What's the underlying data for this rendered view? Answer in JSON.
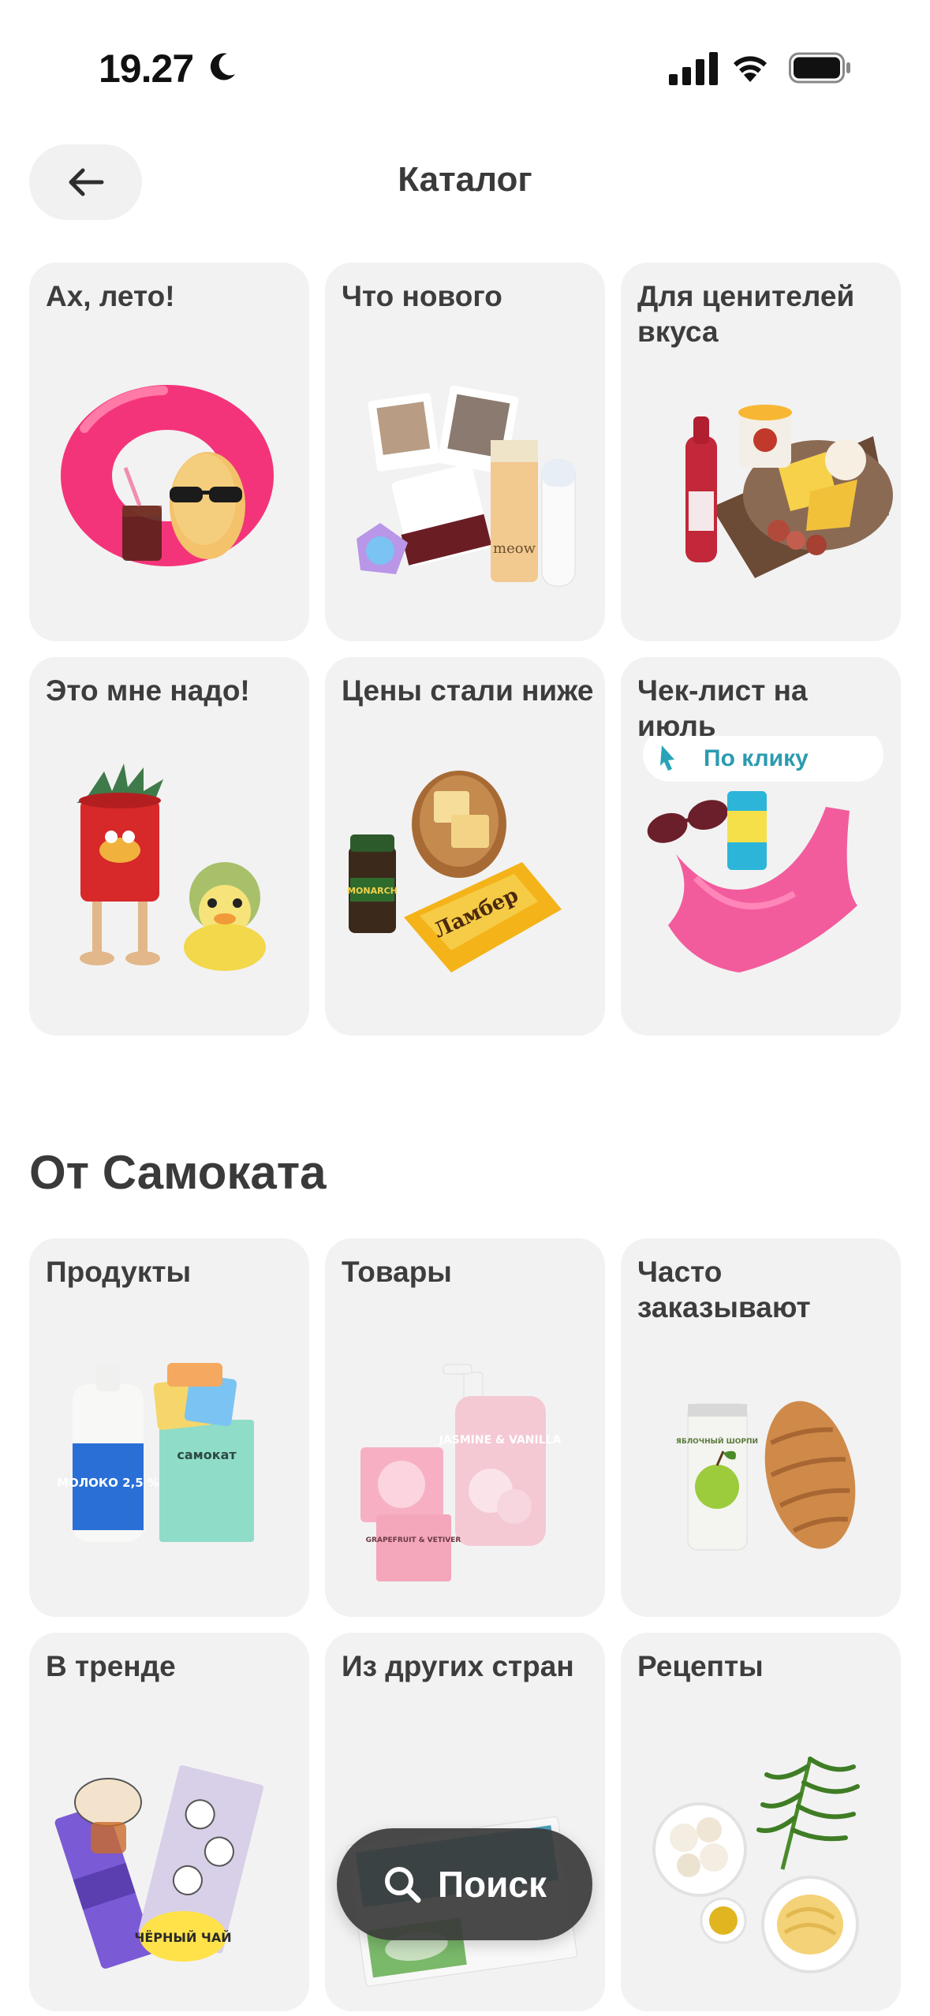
{
  "status_bar": {
    "time": "19.27"
  },
  "header": {
    "title": "Каталог"
  },
  "catalog": {
    "tiles": [
      {
        "label": "Ах, лето!"
      },
      {
        "label": "Что нового"
      },
      {
        "label": "Для ценителей вкуса"
      },
      {
        "label": "Это мне надо!"
      },
      {
        "label": "Цены стали ниже"
      },
      {
        "label": "Чек-лист на июль",
        "badge": "По клику"
      }
    ]
  },
  "section": {
    "title": "От Самоката",
    "tiles": [
      {
        "label": "Продукты"
      },
      {
        "label": "Товары"
      },
      {
        "label": "Часто заказывают"
      },
      {
        "label": "В тренде"
      },
      {
        "label": "Из других стран"
      },
      {
        "label": "Рецепты"
      }
    ]
  },
  "search_button": {
    "label": "Поиск"
  },
  "product_labels": {
    "milk": "МОЛОКО 2,5 %",
    "brand": "самокат",
    "jasmine": "JASMINE & VANILLA",
    "grapefruit": "GRAPEFRUIT & VETIVER",
    "lambert": "Ламбер",
    "monarch": "MONARCH",
    "meow": "meow",
    "tea": "ЧЁРНЫЙ ЧАЙ",
    "apple": "ЯБЛОЧНЫЙ ШОРПИ"
  }
}
